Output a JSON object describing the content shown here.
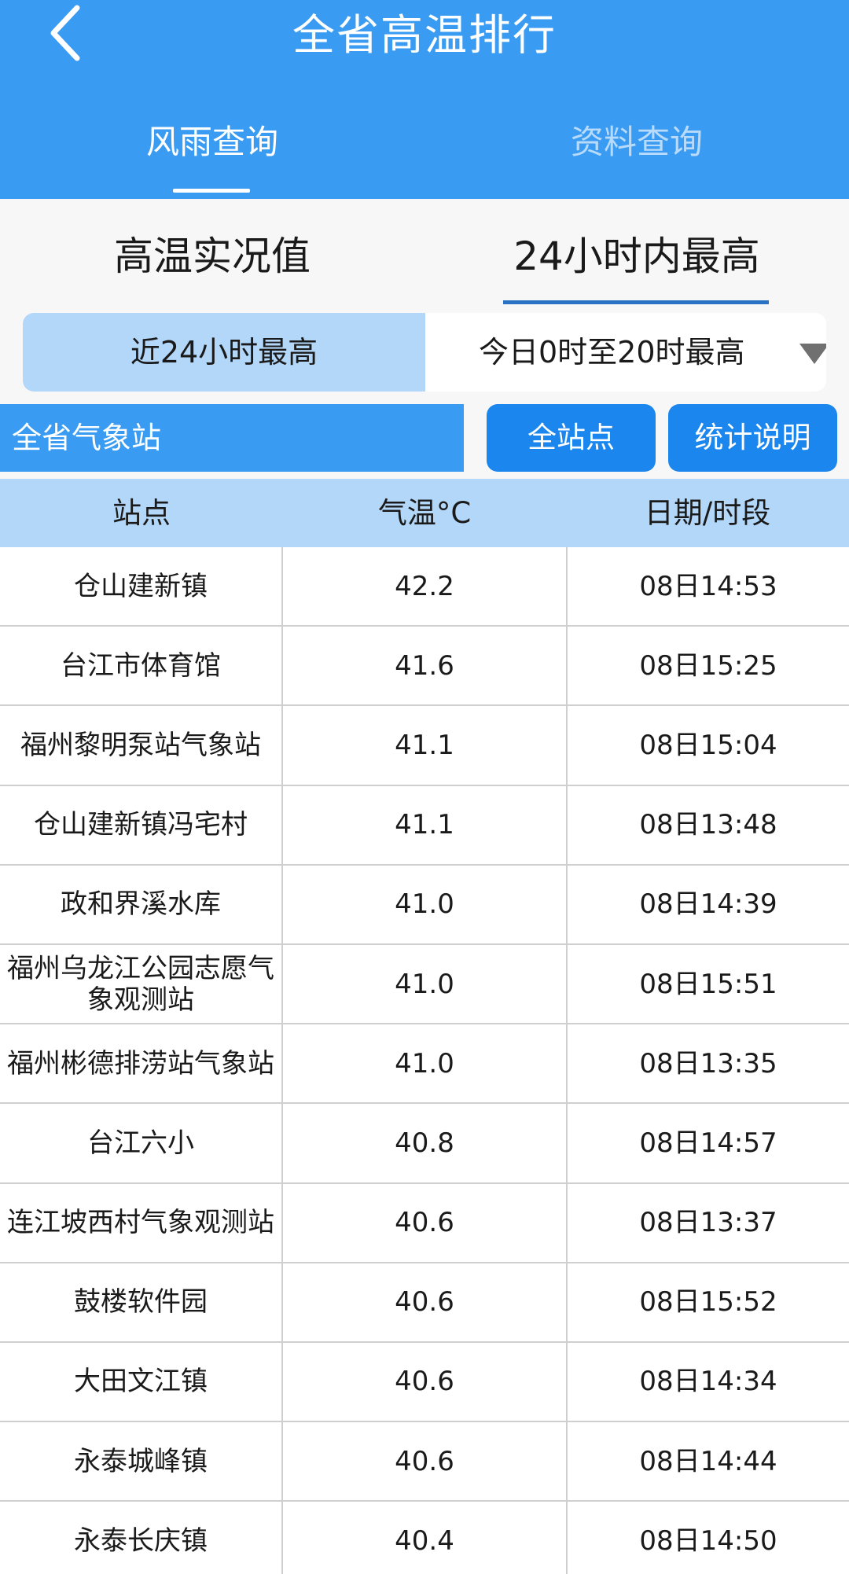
{
  "header": {
    "title": "全省高温排行",
    "tabs": [
      "风雨查询",
      "资料查询"
    ]
  },
  "sub_tabs": [
    "高温实况值",
    "24小时内最高"
  ],
  "segment": {
    "left_label": "近24小时最高",
    "right_label": "今日0时至20时最高"
  },
  "filter": {
    "station_group": "全省气象站",
    "all_stations_button": "全站点",
    "explain_button": "统计说明"
  },
  "table": {
    "columns": [
      "站点",
      "气温°C",
      "日期/时段"
    ],
    "rows": [
      [
        "仓山建新镇",
        "42.2",
        "08日14:53"
      ],
      [
        "台江市体育馆",
        "41.6",
        "08日15:25"
      ],
      [
        "福州黎明泵站气象站",
        "41.1",
        "08日15:04"
      ],
      [
        "仓山建新镇冯宅村",
        "41.1",
        "08日13:48"
      ],
      [
        "政和界溪水库",
        "41.0",
        "08日14:39"
      ],
      [
        "福州乌龙江公园志愿气象观测站",
        "41.0",
        "08日15:51"
      ],
      [
        "福州彬德排涝站气象站",
        "41.0",
        "08日13:35"
      ],
      [
        "台江六小",
        "40.8",
        "08日14:57"
      ],
      [
        "连江坡西村气象观测站",
        "40.6",
        "08日13:37"
      ],
      [
        "鼓楼软件园",
        "40.6",
        "08日15:52"
      ],
      [
        "大田文江镇",
        "40.6",
        "08日14:34"
      ],
      [
        "永泰城峰镇",
        "40.6",
        "08日14:44"
      ],
      [
        "永泰长庆镇",
        "40.4",
        "08日14:50"
      ]
    ]
  },
  "colors": {
    "header_blue": "#3a9bf2",
    "button_blue": "#1a86ee",
    "light_blue": "#b3d7f8",
    "active_underline": "#2a72c4"
  },
  "icons": {
    "back": "chevron-left-icon",
    "dropdown": "triangle-down-icon"
  }
}
